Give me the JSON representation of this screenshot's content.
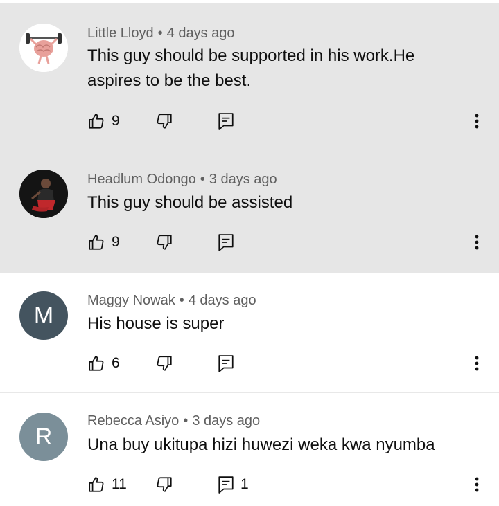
{
  "comments": [
    {
      "author": "Little Lloyd",
      "time": "4 days ago",
      "text": "This guy should be supported in his work.He aspires to be the best.",
      "likes": "9",
      "replies": "",
      "avatar_icon": "brain-lifting-barbell-icon",
      "avatar_color": "#ffffff",
      "highlighted": true
    },
    {
      "author": "Headlum Odongo",
      "time": "3 days ago",
      "text": "This guy  should  be assisted",
      "likes": "9",
      "replies": "",
      "avatar_icon": "person-photo-icon",
      "avatar_color": "#1a1a1a",
      "highlighted": true
    },
    {
      "author": "Maggy Nowak",
      "time": "4 days ago",
      "text": "His house is super",
      "likes": "6",
      "replies": "",
      "avatar_letter": "M",
      "avatar_color": "#44545f",
      "highlighted": false
    },
    {
      "author": "Rebecca Asiyo",
      "time": "3 days ago",
      "text": "Una buy ukitupa hizi huwezi weka kwa nyumba",
      "likes": "11",
      "replies": "1",
      "avatar_letter": "R",
      "avatar_color": "#7b8f99",
      "highlighted": false
    }
  ],
  "separator": "•",
  "icons": {
    "like": "thumbs-up-icon",
    "dislike": "thumbs-down-icon",
    "reply": "reply-comment-icon",
    "more": "more-vertical-icon"
  }
}
